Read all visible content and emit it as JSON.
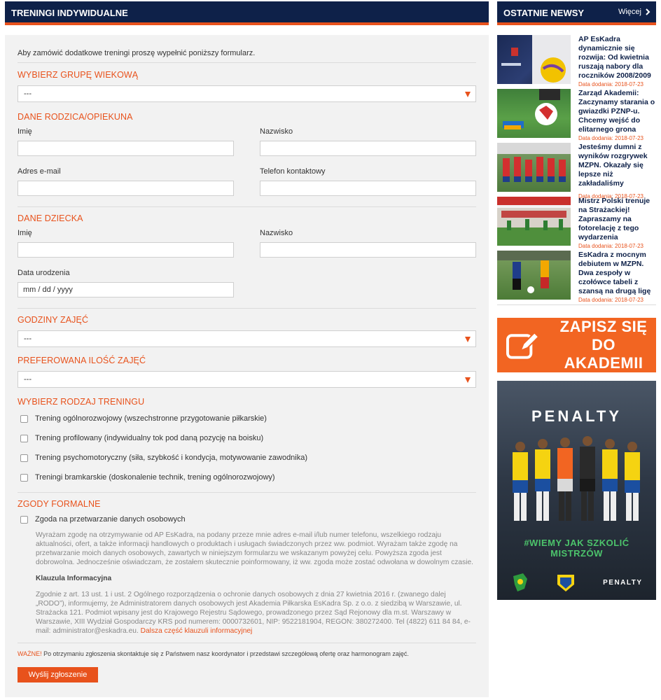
{
  "main": {
    "title": "TRENINGI INDYWIDUALNE",
    "intro": "Aby zamówić dodatkowe treningi proszę wypełnić poniższy formularz.",
    "age_group": {
      "heading": "WYBIERZ GRUPĘ WIEKOWĄ",
      "value": "---"
    },
    "parent": {
      "heading": "DANE RODZICA/OPIEKUNA",
      "first_name_label": "Imię",
      "last_name_label": "Nazwisko",
      "email_label": "Adres e-mail",
      "phone_label": "Telefon kontaktowy"
    },
    "child": {
      "heading": "DANE DZIECKA",
      "first_name_label": "Imię",
      "last_name_label": "Nazwisko",
      "birth_label": "Data urodzenia",
      "birth_placeholder": "mm / dd / yyyy"
    },
    "hours": {
      "heading": "GODZINY ZAJĘĆ",
      "value": "---"
    },
    "amount": {
      "heading": "PREFEROWANA ILOŚĆ ZAJĘĆ",
      "value": "---"
    },
    "training": {
      "heading": "WYBIERZ RODZAJ TRENINGU",
      "options": [
        "Trening ogólnorozwojowy (wszechstronne przygotowanie piłkarskie)",
        "Trening profilowany (indywidualny tok pod daną pozycję na boisku)",
        "Trening psychomotoryczny (siła, szybkość i kondycja, motywowanie zawodnika)",
        "Treningi bramkarskie (doskonalenie technik, trening ogólnorozwojowy)"
      ]
    },
    "consents": {
      "heading": "ZGODY FORMALNE",
      "checkbox_label": "Zgoda na przetwarzanie danych osobowych",
      "consent_text": "Wyrażam zgodę na otrzymywanie od AP EsKadra, na podany przeze mnie adres e-mail i/lub numer telefonu, wszelkiego rodzaju aktualności, ofert, a także informacji handlowych o produktach i usługach świadczonych przez ww. podmiot. Wyrażam także zgodę na przetwarzanie moich danych osobowych, zawartych w niniejszym formularzu we wskazanym powyżej celu. Powyższa zgoda jest dobrowolna. Jednocześnie oświadczam, że zostałem skutecznie poinformowany, iż ww. zgoda może zostać odwołana w dowolnym czasie.",
      "clause_title": "Klauzula Informacyjna",
      "clause_text": "Zgodnie z art. 13 ust. 1 i ust. 2 Ogólnego rozporządzenia o ochronie danych osobowych z dnia 27 kwietnia 2016 r. (zwanego dalej „RODO”), informujemy, że Administratorem danych osobowych jest Akademia Piłkarska EsKadra Sp. z o.o. z siedzibą w Warszawie, ul. Strażacka 121. Podmiot wpisany jest do Krajowego Rejestru Sądowego, prowadzonego przez Sąd Rejonowy dla m.st. Warszawy w Warszawie, XIII Wydział Gospodarczy KRS pod numerem: 0000732601, NIP: 9522181904, REGON: 380272400. Tel (4822) 611 84 84, e-mail: administrator@eskadra.eu.",
      "clause_link": "Dalsza część klauzuli informacyjnej"
    },
    "notice_label": "WAŻNE!",
    "notice_text": " Po otrzymaniu zgłoszenia skontaktuje się z Państwem nasz koordynator i przedstawi szczegółową ofertę oraz harmonogram zajęć.",
    "submit_label": "Wyślij zgłoszenie"
  },
  "sidebar": {
    "title": "OSTATNIE NEWSY",
    "more_label": "Więcej",
    "date_prefix": "Data dodania: ",
    "news": [
      {
        "title": "AP EsKadra dynamicznie się rozwija: Od kwietnia ruszają nabory dla roczników 2008/2009",
        "date": "2018-07-23"
      },
      {
        "title": "Zarząd Akademii: Zaczynamy starania o gwiazdki PZNP-u. Chcemy wejść do elitarnego grona",
        "date": "2018-07-23"
      },
      {
        "title": "Jesteśmy dumni z wyników rozgrywek MZPN. Okazały się lepsze niż zakładaliśmy",
        "date": "2018-07-23"
      },
      {
        "title": "Mistrz Polski trenuje na Strażackiej! Zapraszamy na fotorelację z tego wydarzenia",
        "date": "2018-07-23"
      },
      {
        "title": "EsKadra z mocnym debiutem w MZPN. Dwa zespoły w czołówce tabeli z szansą na drugą ligę",
        "date": "2018-07-23"
      }
    ],
    "signup_banner": {
      "line1": "ZAPISZ SIĘ",
      "line2": "DO AKADEMII"
    },
    "ad": {
      "brand": "PENALTY",
      "slogan": "#WIEMY JAK SZKOLIĆ MISTRZÓW",
      "footer_brand": "PENALTY"
    }
  }
}
